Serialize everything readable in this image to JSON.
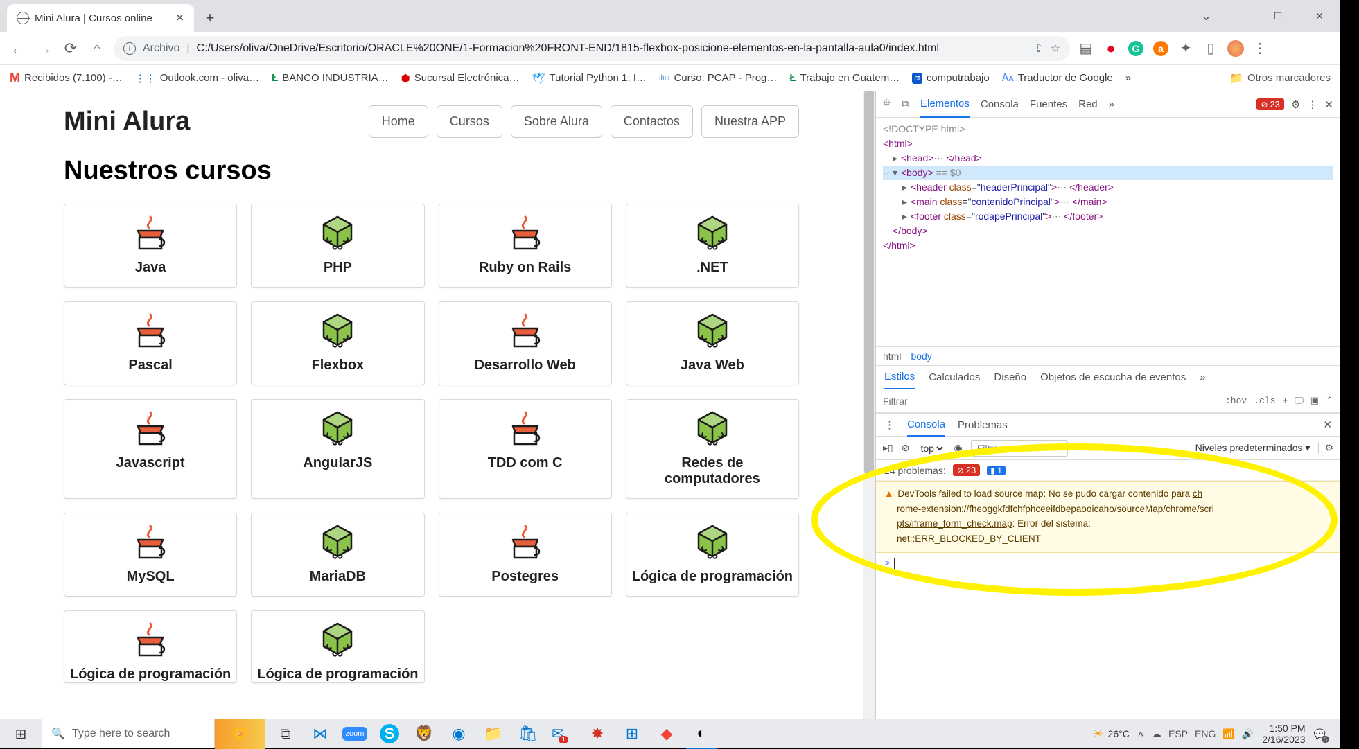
{
  "tab": {
    "title": "Mini Alura | Cursos online"
  },
  "window": {
    "min": "—",
    "max": "☐",
    "close": "✕"
  },
  "url": {
    "scheme": "Archivo",
    "path": "C:/Users/oliva/OneDrive/Escritorio/ORACLE%20ONE/1-Formacion%20FRONT-END/1815-flexbox-posicione-elementos-en-la-pantalla-aula0/index.html"
  },
  "bookmarks": [
    "Recibidos (7.100) -…",
    "Outlook.com - oliva…",
    "BANCO INDUSTRIA…",
    "Sucursal Electrónica…",
    "Tutorial Python 1: I…",
    "Curso: PCAP - Prog…",
    "Trabajo en Guatem…",
    "computrabajo",
    "Traductor de Google"
  ],
  "bookmarks_more": "»",
  "bookmarks_other": "Otros marcadores",
  "page": {
    "logo": "Mini Alura",
    "nav": [
      "Home",
      "Cursos",
      "Sobre Alura",
      "Contactos",
      "Nuestra APP"
    ],
    "heading": "Nuestros cursos",
    "courses": [
      {
        "title": "Java",
        "type": "java"
      },
      {
        "title": "PHP",
        "type": "php"
      },
      {
        "title": "Ruby on Rails",
        "type": "java"
      },
      {
        "title": ".NET",
        "type": "php"
      },
      {
        "title": "Pascal",
        "type": "java"
      },
      {
        "title": "Flexbox",
        "type": "php"
      },
      {
        "title": "Desarrollo Web",
        "type": "java"
      },
      {
        "title": "Java Web",
        "type": "php"
      },
      {
        "title": "Javascript",
        "type": "java"
      },
      {
        "title": "AngularJS",
        "type": "php"
      },
      {
        "title": "TDD com C",
        "type": "java"
      },
      {
        "title": "Redes de computadores",
        "type": "php"
      },
      {
        "title": "MySQL",
        "type": "java"
      },
      {
        "title": "MariaDB",
        "type": "php"
      },
      {
        "title": "Postegres",
        "type": "java"
      },
      {
        "title": "Lógica de programación",
        "type": "php"
      },
      {
        "title": "Lógica de programación",
        "type": "java"
      },
      {
        "title": "Lógica de programación",
        "type": "php"
      }
    ]
  },
  "devtools": {
    "tabs": [
      "Elementos",
      "Consola",
      "Fuentes",
      "Red"
    ],
    "more": "»",
    "error_count": "23",
    "dom": {
      "doctype": "<!DOCTYPE html>",
      "html_open": "<html>",
      "head": "<head>…</head>",
      "body_open": "<body>",
      "body_sel": "== $0",
      "header": "<header class=\"headerPrincipal\">…</header>",
      "main": "<main class=\"contenidoPrincipal\">…</main>",
      "footer": "<footer class=\"rodapePrincipal\">…</footer>",
      "body_close": "</body>",
      "html_close": "</html>"
    },
    "crumbs": [
      "html",
      "body"
    ],
    "style_tabs": [
      "Estilos",
      "Calculados",
      "Diseño",
      "Objetos de escucha de eventos"
    ],
    "style_more": "»",
    "filter_ph": "Filtrar",
    "tools": [
      ":hov",
      ".cls",
      "+"
    ],
    "drawer_tabs": [
      "Consola",
      "Problemas"
    ],
    "ctx": "top",
    "filter2_ph": "Filtrar",
    "levels": "Niveles predeterminados",
    "problems_label": "24 problemas:",
    "problems_err": "23",
    "problems_info": "1",
    "warn": {
      "l1": "DevTools failed to load source map: No se pudo cargar contenido para ",
      "link1": "ch",
      "link2": "rome-extension://fheoggkfdfchfphceeifdbepaooicaho/sourceMap/chrome/scri",
      "link3": "pts/iframe_form_check.map",
      "l2": ": Error del sistema:",
      "l3": "net::ERR_BLOCKED_BY_CLIENT"
    },
    "prompt": ">"
  },
  "taskbar": {
    "search_ph": "Type here to search",
    "weather": "26°C",
    "lang1": "ESP",
    "lang2": "ENG",
    "time": "1:50 PM",
    "date": "2/16/2023"
  }
}
